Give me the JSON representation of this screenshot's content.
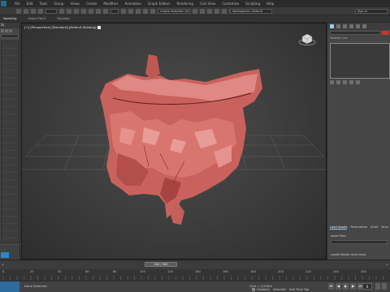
{
  "menu": {
    "items": [
      "File",
      "Edit",
      "Tools",
      "Group",
      "Views",
      "Create",
      "Modifiers",
      "Animation",
      "Graph Editors",
      "Rendering",
      "Civil View",
      "Customize",
      "Scripting",
      "Help"
    ]
  },
  "toolbar": {
    "create_selection_set": "Create Selection Se",
    "workspace": "Workspaces: Default",
    "user": "Sign In"
  },
  "subtoolbar": {
    "tabs": [
      "Modeling",
      "Object Paint",
      "Populate"
    ]
  },
  "explorer": {
    "title": "Sc"
  },
  "viewport": {
    "label": "[+] [Perspective] [Standard] [Default Shading]"
  },
  "command_panel": {
    "modifier_list": "Modifier List",
    "rollout_tabs": [
      "Load Assets",
      "Parameters",
      "Shelf",
      "Versi"
    ],
    "asset_path_label": "Asset Path",
    "footer_text": "Loaded Models Serial Asset"
  },
  "timeline": {
    "slider_label": "160 / 260",
    "ticks": [
      "0",
      "20",
      "40",
      "60",
      "80",
      "100",
      "120",
      "140",
      "160",
      "180",
      "200",
      "220",
      "240",
      "260"
    ]
  },
  "status": {
    "left": "None Selected",
    "grid": "Grid = 0,254m",
    "auto_key": "Disabled",
    "selected": "Selected",
    "add_time_tag": "Add Time Tag",
    "frame": "0"
  },
  "colors": {
    "model": "#d9756f",
    "model_shadow": "#8f3a36",
    "accent": "#2b87c7"
  }
}
